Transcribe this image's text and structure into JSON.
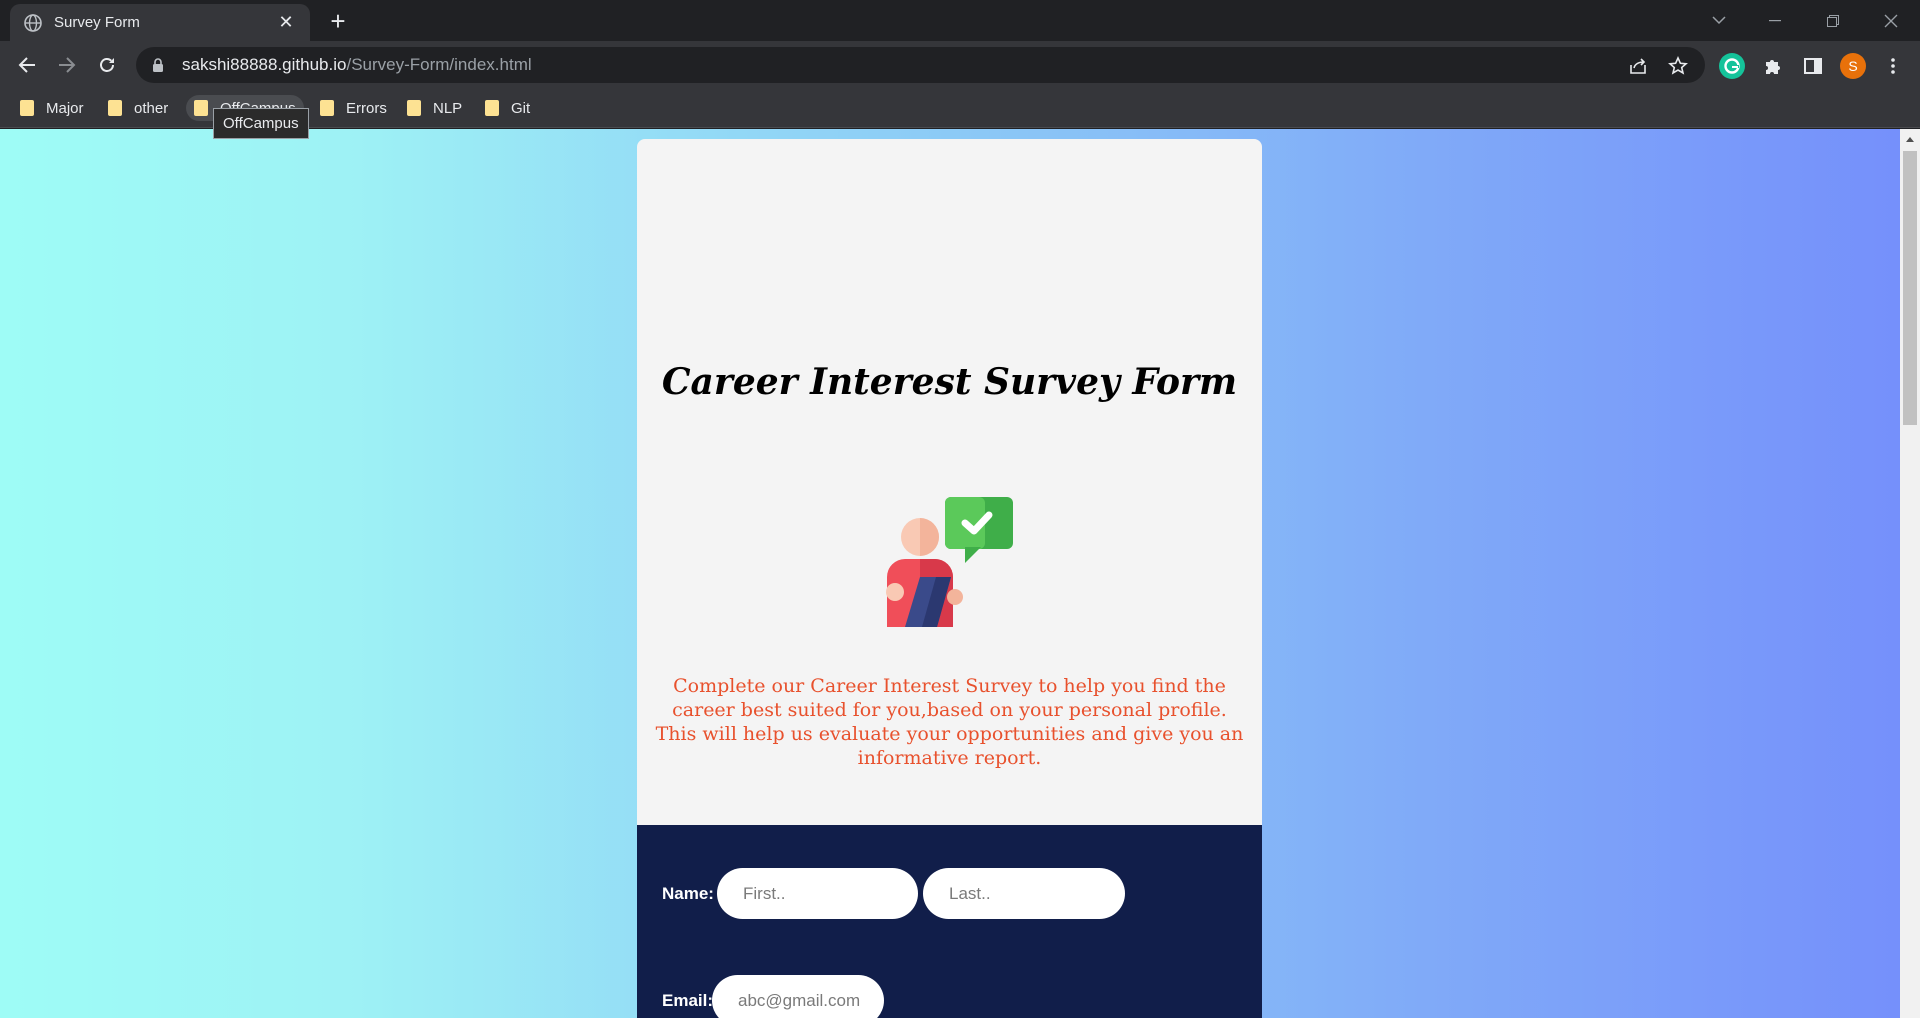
{
  "browser": {
    "tab": {
      "title": "Survey Form"
    },
    "url": {
      "host": "sakshi88888.github.io",
      "path": "/Survey-Form/index.html"
    },
    "profile_initial": "S",
    "bookmarks": [
      {
        "label": "Major"
      },
      {
        "label": "other"
      },
      {
        "label": "OffCampus"
      },
      {
        "label": "Errors"
      },
      {
        "label": "NLP"
      },
      {
        "label": "Git"
      }
    ],
    "tooltip": "OffCampus"
  },
  "page": {
    "title": "Career Interest Survey Form",
    "description_line1": "Complete our Career Interest Survey to help you find the career best suited for you,based on your personal profile.",
    "description_line2": "This will help us evaluate your opportunities and give you an informative report.",
    "form": {
      "name_label": "Name:",
      "first_placeholder": "First..",
      "last_placeholder": "Last..",
      "email_label": "Email:",
      "email_placeholder": "abc@gmail.com"
    }
  },
  "colors": {
    "description_text": "#e8512d",
    "form_background": "#111e4a",
    "card_background": "#f4f4f4"
  }
}
